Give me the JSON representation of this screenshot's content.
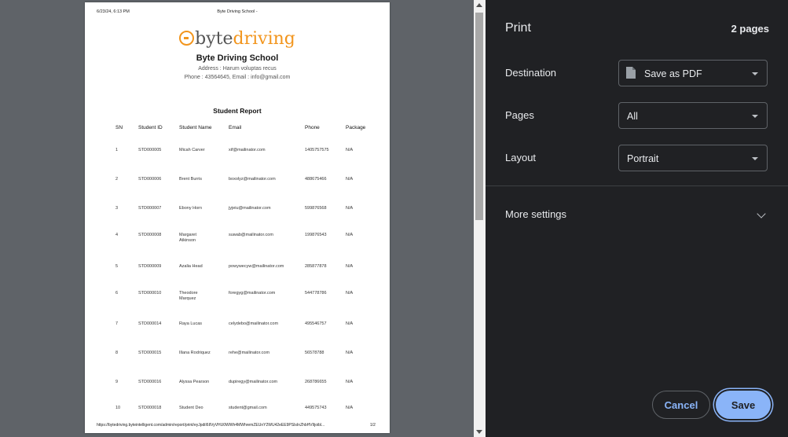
{
  "preview": {
    "header_datetime": "6/23/24, 6:13 PM",
    "header_title": "Byte Driving School -",
    "logo": {
      "part1": "byte",
      "part2": "driving",
      "accent": "#f2951d"
    },
    "school_name": "Byte Driving School",
    "address": "Address : Harum voluptas recus",
    "contact": "Phone : 43564645, Email : info@gmail.com",
    "report_title": "Student Report",
    "columns": [
      "SN",
      "Student ID",
      "Student Name",
      "Email",
      "Phone",
      "Package"
    ],
    "rows": [
      {
        "sn": "1",
        "id": "STD000005",
        "name": "Micah Carver",
        "email": "xif@mailinator.com",
        "phone": "1405757575",
        "package": "N/A"
      },
      {
        "sn": "2",
        "id": "STD000006",
        "name": "Brent Burris",
        "email": "boxolyz@mailinator.com",
        "phone": "488675466",
        "package": "N/A"
      },
      {
        "sn": "3",
        "id": "STD000007",
        "name": "Ebony Horn",
        "email": "jyjeiu@mailinator.com",
        "phone": "599876568",
        "package": "N/A"
      },
      {
        "sn": "4",
        "id": "STD000008",
        "name": "Margaret Atkinson",
        "email": "suwab@mailinator.com",
        "phone": "199876543",
        "package": "N/A"
      },
      {
        "sn": "5",
        "id": "STD000009",
        "name": "Azalia Head",
        "email": "powywecyw@mailinator.com",
        "phone": "285877878",
        "package": "N/A"
      },
      {
        "sn": "6",
        "id": "STD000010",
        "name": "Theodore Marquez",
        "email": "foregyg@mailinator.com",
        "phone": "544778786",
        "package": "N/A"
      },
      {
        "sn": "7",
        "id": "STD000014",
        "name": "Raya Lucas",
        "email": "celydebo@mailinator.com",
        "phone": "495546757",
        "package": "N/A"
      },
      {
        "sn": "8",
        "id": "STD000015",
        "name": "Illana Rodriquez",
        "email": "rehe@mailinator.com",
        "phone": "56578788",
        "package": "N/A"
      },
      {
        "sn": "9",
        "id": "STD000016",
        "name": "Alyssa Pearson",
        "email": "dupiregy@mailinator.com",
        "phone": "268786655",
        "package": "N/A"
      },
      {
        "sn": "10",
        "id": "STD000018",
        "name": "Student Deo",
        "email": "student@gmail.com",
        "phone": "449575743",
        "package": "N/A"
      }
    ],
    "footer_url": "https://bytedriving.byteintelligent.com/admin/report/print/eyJpdiI6IlVyVHU0WWh4MWhremZEUnY2WU42eEE9PSIsInZhbHVlIjoibl...",
    "footer_page": "1/2"
  },
  "panel": {
    "title": "Print",
    "page_count": "2 pages",
    "destination": {
      "label": "Destination",
      "value": "Save as PDF",
      "icon": "file-icon"
    },
    "pages": {
      "label": "Pages",
      "value": "All"
    },
    "layout": {
      "label": "Layout",
      "value": "Portrait"
    },
    "more_settings": "More settings",
    "cancel_label": "Cancel",
    "save_label": "Save",
    "colors": {
      "panel_bg": "#202124",
      "accent": "#8ab4f8",
      "preview_bg": "#5f6368"
    }
  }
}
